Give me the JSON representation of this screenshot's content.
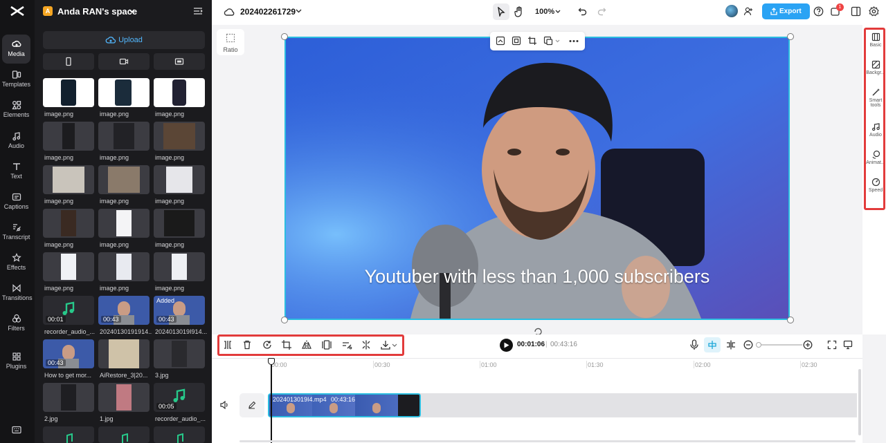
{
  "app": {
    "space_badge": "A",
    "space_name": "Anda RAN's space",
    "project_name": "202402261729"
  },
  "leftnav": [
    {
      "label": "Media",
      "icon": "media-icon"
    },
    {
      "label": "Templates",
      "icon": "templates-icon"
    },
    {
      "label": "Elements",
      "icon": "elements-icon"
    },
    {
      "label": "Audio",
      "icon": "audio-icon"
    },
    {
      "label": "Text",
      "icon": "text-icon"
    },
    {
      "label": "Captions",
      "icon": "captions-icon"
    },
    {
      "label": "Transcript",
      "icon": "transcript-icon"
    },
    {
      "label": "Effects",
      "icon": "effects-icon"
    },
    {
      "label": "Transitions",
      "icon": "transitions-icon"
    },
    {
      "label": "Filters",
      "icon": "filters-icon"
    },
    {
      "label": "Plugins",
      "icon": "plugins-icon"
    }
  ],
  "media": {
    "upload_label": "Upload",
    "items": [
      {
        "label": "image.png"
      },
      {
        "label": "image.png"
      },
      {
        "label": "image.png"
      },
      {
        "label": "image.png"
      },
      {
        "label": "image.png"
      },
      {
        "label": "image.png"
      },
      {
        "label": "image.png"
      },
      {
        "label": "image.png"
      },
      {
        "label": "image.png"
      },
      {
        "label": "image.png"
      },
      {
        "label": "image.png"
      },
      {
        "label": "image.png"
      },
      {
        "label": "image.png"
      },
      {
        "label": "image.png"
      },
      {
        "label": "image.png"
      },
      {
        "label": "recorder_audio_...",
        "duration": "00:01"
      },
      {
        "label": "20240130191914...",
        "duration": "00:43"
      },
      {
        "label": "2024013019I914...",
        "duration": "00:43",
        "badge": "Added"
      },
      {
        "label": "How to get mor...",
        "duration": "00:43"
      },
      {
        "label": "AiRestore_3|20..."
      },
      {
        "label": "3.jpg"
      },
      {
        "label": "2.jpg"
      },
      {
        "label": "1.jpg"
      },
      {
        "label": "recorder_audio_...",
        "duration": "00:05"
      }
    ]
  },
  "topbar": {
    "zoom": "100%",
    "export_label": "Export",
    "notif_count": "1"
  },
  "canvas": {
    "ratio_label": "Ratio",
    "caption": "Youtuber with less than 1,000 subscribers"
  },
  "rightbar": [
    {
      "label": "Basic",
      "icon": "basic-icon"
    },
    {
      "label": "Backgr...",
      "icon": "background-icon"
    },
    {
      "label": "Smart tools",
      "icon": "smart-tools-icon"
    },
    {
      "label": "Audio",
      "icon": "audio-icon"
    },
    {
      "label": "Animat...",
      "icon": "animation-icon"
    },
    {
      "label": "Speed",
      "icon": "speed-icon"
    }
  ],
  "playback": {
    "current": "00:01:06",
    "separator": "|",
    "total": "00:43:16"
  },
  "timeline": {
    "ticks": [
      "00:00",
      "00:30",
      "01:00",
      "01:30",
      "02:00",
      "02:30"
    ],
    "clip_name": "2024013019I4.mp4",
    "clip_duration": "00:43:16"
  },
  "colors": {
    "accent": "#2aa3f4",
    "selection": "#2bbde0",
    "highlight": "#e23b3b",
    "nav_bg": "#141416"
  }
}
